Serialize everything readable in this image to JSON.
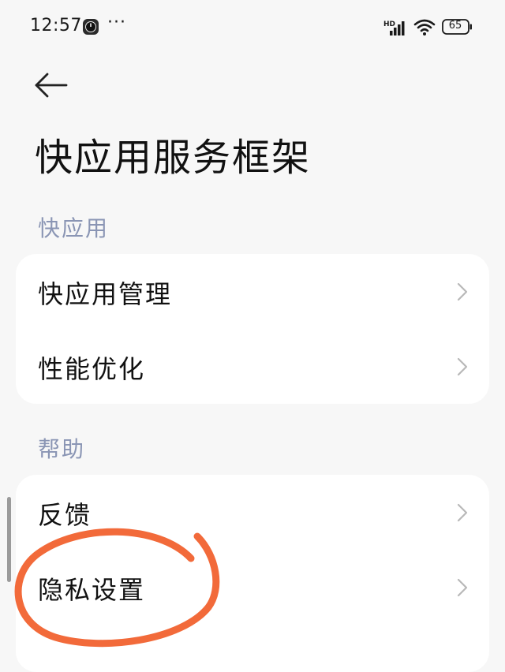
{
  "status_bar": {
    "time": "12:57",
    "more": "···",
    "signal_tag": "HD",
    "battery": "65"
  },
  "page": {
    "title": "快应用服务框架"
  },
  "sections": [
    {
      "label": "快应用",
      "items": [
        {
          "label": "快应用管理"
        },
        {
          "label": "性能优化"
        }
      ]
    },
    {
      "label": "帮助",
      "items": [
        {
          "label": "反馈"
        },
        {
          "label": "隐私设置"
        }
      ]
    }
  ],
  "colors": {
    "background": "#f7f7f7",
    "card": "#ffffff",
    "section_label": "#8a95b4",
    "chevron": "#b8b8b8",
    "annotation": "#f26a3a"
  }
}
